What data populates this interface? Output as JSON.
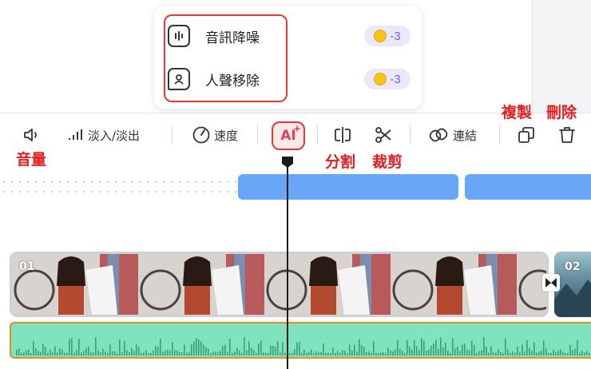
{
  "ai_menu": {
    "items": [
      {
        "label": "音訊降噪",
        "credit": "-3",
        "icon": "audio-denoise-icon"
      },
      {
        "label": "人聲移除",
        "credit": "-3",
        "icon": "vocal-remove-icon"
      }
    ]
  },
  "toolbar": {
    "fade_label": "淡入/淡出",
    "speed_label": "速度",
    "ai_label": "AI",
    "link_label": "連結"
  },
  "annotations": {
    "volume": "音量",
    "split": "分割",
    "trim": "裁剪",
    "copy": "複製",
    "delete": "刪除"
  },
  "timeline": {
    "clip1_label": "01",
    "clip2_label": "02"
  },
  "colors": {
    "accent_red": "#e53935",
    "credit_purple": "#7a5ce0",
    "blue_track": "#6aa6f8",
    "audio_green": "#7fe3c0",
    "audio_border": "#f08a24"
  }
}
